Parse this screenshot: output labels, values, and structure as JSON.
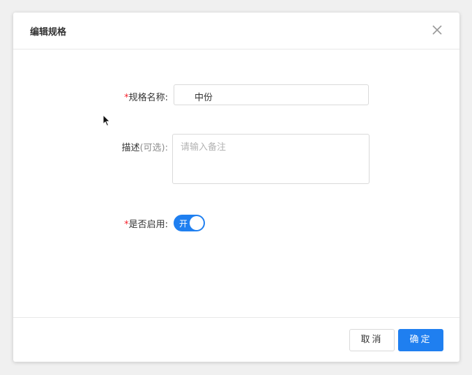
{
  "dialog": {
    "title": "编辑规格",
    "close_icon": "close-icon"
  },
  "form": {
    "spec_name": {
      "required_mark": "*",
      "label": "规格名称:",
      "value": "中份"
    },
    "description": {
      "label": "描述",
      "hint": "(可选):",
      "placeholder": "请输入备注",
      "value": ""
    },
    "enabled": {
      "required_mark": "*",
      "label": "是否启用:",
      "switch_text": "开",
      "state": true
    }
  },
  "footer": {
    "cancel_label": "取消",
    "ok_label": "确定"
  },
  "colors": {
    "primary": "#1f7ff0",
    "required": "#f5222d",
    "border": "#d9d9d9"
  },
  "cursor_icon": "arrow-cursor-icon"
}
